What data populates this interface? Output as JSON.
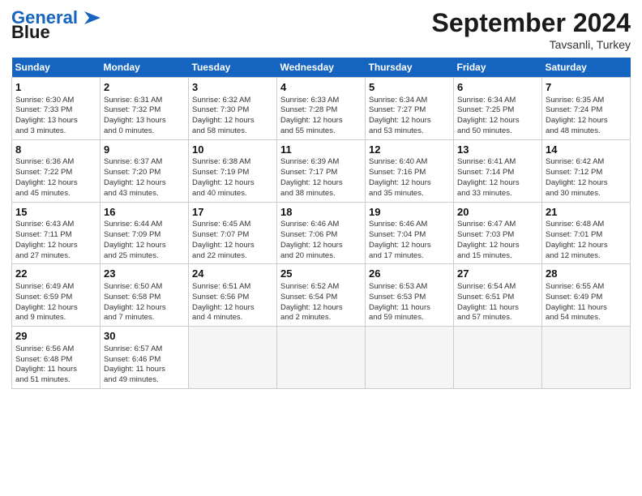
{
  "header": {
    "logo_line1": "General",
    "logo_line2": "Blue",
    "month": "September 2024",
    "location": "Tavsanli, Turkey"
  },
  "days_of_week": [
    "Sunday",
    "Monday",
    "Tuesday",
    "Wednesday",
    "Thursday",
    "Friday",
    "Saturday"
  ],
  "weeks": [
    [
      {
        "day": 1,
        "lines": [
          "Sunrise: 6:30 AM",
          "Sunset: 7:33 PM",
          "Daylight: 13 hours",
          "and 3 minutes."
        ]
      },
      {
        "day": 2,
        "lines": [
          "Sunrise: 6:31 AM",
          "Sunset: 7:32 PM",
          "Daylight: 13 hours",
          "and 0 minutes."
        ]
      },
      {
        "day": 3,
        "lines": [
          "Sunrise: 6:32 AM",
          "Sunset: 7:30 PM",
          "Daylight: 12 hours",
          "and 58 minutes."
        ]
      },
      {
        "day": 4,
        "lines": [
          "Sunrise: 6:33 AM",
          "Sunset: 7:28 PM",
          "Daylight: 12 hours",
          "and 55 minutes."
        ]
      },
      {
        "day": 5,
        "lines": [
          "Sunrise: 6:34 AM",
          "Sunset: 7:27 PM",
          "Daylight: 12 hours",
          "and 53 minutes."
        ]
      },
      {
        "day": 6,
        "lines": [
          "Sunrise: 6:34 AM",
          "Sunset: 7:25 PM",
          "Daylight: 12 hours",
          "and 50 minutes."
        ]
      },
      {
        "day": 7,
        "lines": [
          "Sunrise: 6:35 AM",
          "Sunset: 7:24 PM",
          "Daylight: 12 hours",
          "and 48 minutes."
        ]
      }
    ],
    [
      {
        "day": 8,
        "lines": [
          "Sunrise: 6:36 AM",
          "Sunset: 7:22 PM",
          "Daylight: 12 hours",
          "and 45 minutes."
        ]
      },
      {
        "day": 9,
        "lines": [
          "Sunrise: 6:37 AM",
          "Sunset: 7:20 PM",
          "Daylight: 12 hours",
          "and 43 minutes."
        ]
      },
      {
        "day": 10,
        "lines": [
          "Sunrise: 6:38 AM",
          "Sunset: 7:19 PM",
          "Daylight: 12 hours",
          "and 40 minutes."
        ]
      },
      {
        "day": 11,
        "lines": [
          "Sunrise: 6:39 AM",
          "Sunset: 7:17 PM",
          "Daylight: 12 hours",
          "and 38 minutes."
        ]
      },
      {
        "day": 12,
        "lines": [
          "Sunrise: 6:40 AM",
          "Sunset: 7:16 PM",
          "Daylight: 12 hours",
          "and 35 minutes."
        ]
      },
      {
        "day": 13,
        "lines": [
          "Sunrise: 6:41 AM",
          "Sunset: 7:14 PM",
          "Daylight: 12 hours",
          "and 33 minutes."
        ]
      },
      {
        "day": 14,
        "lines": [
          "Sunrise: 6:42 AM",
          "Sunset: 7:12 PM",
          "Daylight: 12 hours",
          "and 30 minutes."
        ]
      }
    ],
    [
      {
        "day": 15,
        "lines": [
          "Sunrise: 6:43 AM",
          "Sunset: 7:11 PM",
          "Daylight: 12 hours",
          "and 27 minutes."
        ]
      },
      {
        "day": 16,
        "lines": [
          "Sunrise: 6:44 AM",
          "Sunset: 7:09 PM",
          "Daylight: 12 hours",
          "and 25 minutes."
        ]
      },
      {
        "day": 17,
        "lines": [
          "Sunrise: 6:45 AM",
          "Sunset: 7:07 PM",
          "Daylight: 12 hours",
          "and 22 minutes."
        ]
      },
      {
        "day": 18,
        "lines": [
          "Sunrise: 6:46 AM",
          "Sunset: 7:06 PM",
          "Daylight: 12 hours",
          "and 20 minutes."
        ]
      },
      {
        "day": 19,
        "lines": [
          "Sunrise: 6:46 AM",
          "Sunset: 7:04 PM",
          "Daylight: 12 hours",
          "and 17 minutes."
        ]
      },
      {
        "day": 20,
        "lines": [
          "Sunrise: 6:47 AM",
          "Sunset: 7:03 PM",
          "Daylight: 12 hours",
          "and 15 minutes."
        ]
      },
      {
        "day": 21,
        "lines": [
          "Sunrise: 6:48 AM",
          "Sunset: 7:01 PM",
          "Daylight: 12 hours",
          "and 12 minutes."
        ]
      }
    ],
    [
      {
        "day": 22,
        "lines": [
          "Sunrise: 6:49 AM",
          "Sunset: 6:59 PM",
          "Daylight: 12 hours",
          "and 9 minutes."
        ]
      },
      {
        "day": 23,
        "lines": [
          "Sunrise: 6:50 AM",
          "Sunset: 6:58 PM",
          "Daylight: 12 hours",
          "and 7 minutes."
        ]
      },
      {
        "day": 24,
        "lines": [
          "Sunrise: 6:51 AM",
          "Sunset: 6:56 PM",
          "Daylight: 12 hours",
          "and 4 minutes."
        ]
      },
      {
        "day": 25,
        "lines": [
          "Sunrise: 6:52 AM",
          "Sunset: 6:54 PM",
          "Daylight: 12 hours",
          "and 2 minutes."
        ]
      },
      {
        "day": 26,
        "lines": [
          "Sunrise: 6:53 AM",
          "Sunset: 6:53 PM",
          "Daylight: 11 hours",
          "and 59 minutes."
        ]
      },
      {
        "day": 27,
        "lines": [
          "Sunrise: 6:54 AM",
          "Sunset: 6:51 PM",
          "Daylight: 11 hours",
          "and 57 minutes."
        ]
      },
      {
        "day": 28,
        "lines": [
          "Sunrise: 6:55 AM",
          "Sunset: 6:49 PM",
          "Daylight: 11 hours",
          "and 54 minutes."
        ]
      }
    ],
    [
      {
        "day": 29,
        "lines": [
          "Sunrise: 6:56 AM",
          "Sunset: 6:48 PM",
          "Daylight: 11 hours",
          "and 51 minutes."
        ]
      },
      {
        "day": 30,
        "lines": [
          "Sunrise: 6:57 AM",
          "Sunset: 6:46 PM",
          "Daylight: 11 hours",
          "and 49 minutes."
        ]
      },
      null,
      null,
      null,
      null,
      null
    ]
  ]
}
